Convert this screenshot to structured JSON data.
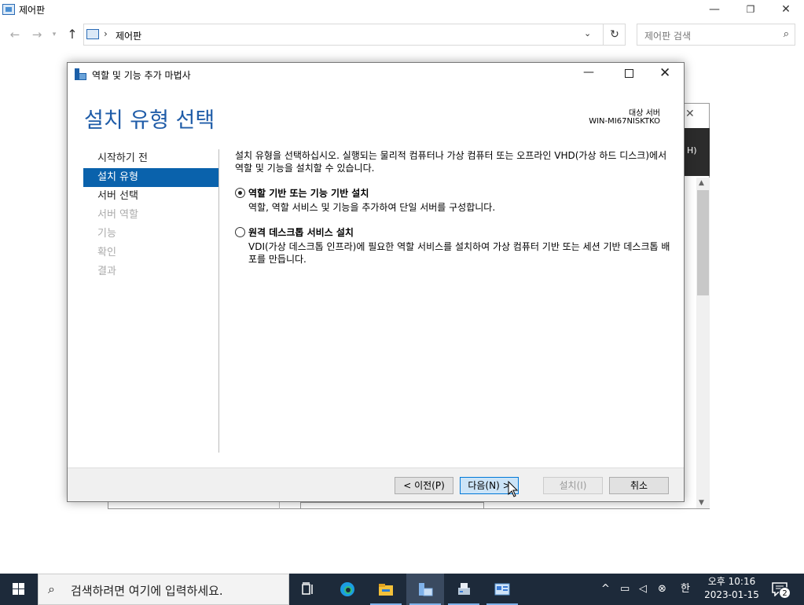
{
  "control_panel": {
    "title": "제어판",
    "address": "제어판",
    "search_placeholder": "제어판 검색",
    "min_glyph": "—",
    "max_glyph": "❐",
    "close_glyph": "✕"
  },
  "background_window": {
    "fragment": "H)"
  },
  "wizard": {
    "title": "역할 및 기능 추가 마법사",
    "heading": "설치 유형 선택",
    "target_label": "대상 서버",
    "target_server": "WIN-MI67NISKTKO",
    "nav": [
      {
        "label": "시작하기 전",
        "state": "normal"
      },
      {
        "label": "설치 유형",
        "state": "active"
      },
      {
        "label": "서버 선택",
        "state": "normal"
      },
      {
        "label": "서버 역할",
        "state": "disabled"
      },
      {
        "label": "기능",
        "state": "disabled"
      },
      {
        "label": "확인",
        "state": "disabled"
      },
      {
        "label": "결과",
        "state": "disabled"
      }
    ],
    "description": "설치 유형을 선택하십시오. 실행되는 물리적 컴퓨터나 가상 컴퓨터 또는 오프라인 VHD(가상 하드 디스크)에서 역할 및 기능을 설치할 수 있습니다.",
    "options": [
      {
        "title": "역할 기반 또는 기능 기반 설치",
        "desc": "역할, 역할 서비스 및 기능을 추가하여 단일 서버를 구성합니다.",
        "selected": true
      },
      {
        "title": "원격 데스크톱 서비스 설치",
        "desc": "VDI(가상 데스크톱 인프라)에 필요한 역할 서비스를 설치하여 가상 컴퓨터 기반 또는 세션 기반 데스크톱 배포를 만듭니다.",
        "selected": false
      }
    ],
    "buttons": {
      "prev": "< 이전(P)",
      "next": "다음(N) >",
      "install": "설치(I)",
      "cancel": "취소"
    }
  },
  "taskbar": {
    "search_placeholder": "검색하려면 여기에 입력하세요.",
    "ime": "한",
    "time": "오후 10:16",
    "date": "2023-01-15",
    "notification_count": "2"
  },
  "colors": {
    "accent": "#0a62ac",
    "heading": "#1f5ca8",
    "taskbar": "#1d2a3a"
  }
}
